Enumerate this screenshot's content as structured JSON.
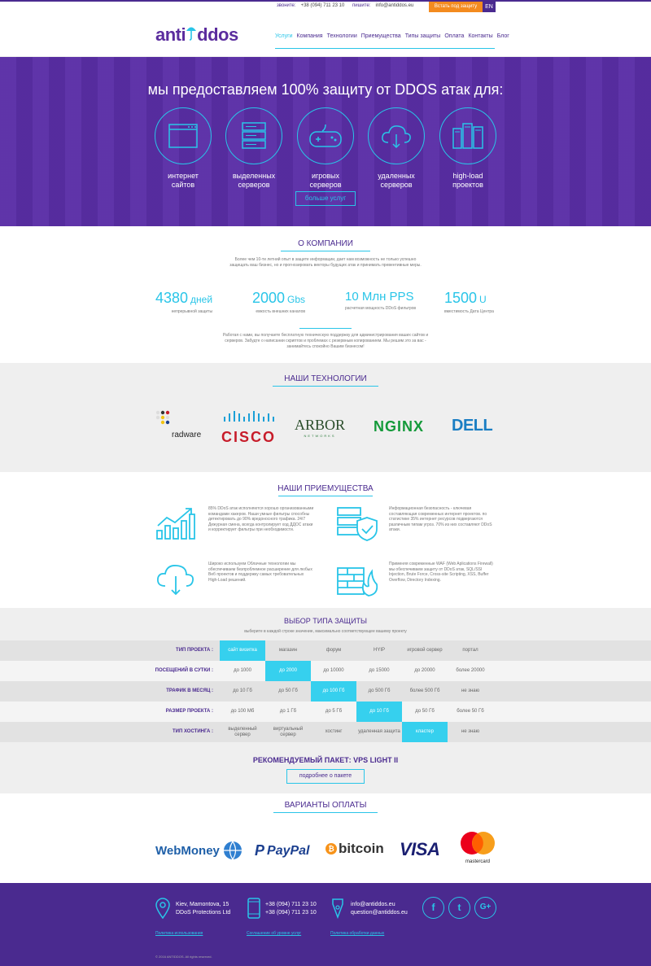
{
  "topbar": {
    "call_label": "звоните:",
    "phone": "+38 (094) 711 23 10",
    "write_label": "пишите:",
    "email": "info@antiddos.eu",
    "cta": "Встать под защиту",
    "lang": "EN"
  },
  "header": {
    "logo_left": "anti",
    "logo_right": "ddos",
    "nav": [
      "Услуги",
      "Компания",
      "Технологии",
      "Приемущества",
      "Типы защиты",
      "Оплата",
      "Контакты",
      "Блог"
    ]
  },
  "hero": {
    "title": "мы предоставляем 100% защиту от DDOS атак для:",
    "services": [
      {
        "icon": "browser-window-icon",
        "line1": "интернет",
        "line2": "сайтов"
      },
      {
        "icon": "server-stack-icon",
        "line1": "выделенных",
        "line2": "серверов"
      },
      {
        "icon": "gamepad-icon",
        "line1": "игровых",
        "line2": "серверов"
      },
      {
        "icon": "cloud-download-icon",
        "line1": "удаленных",
        "line2": "серверов"
      },
      {
        "icon": "server-rack-icon",
        "line1": "high-load",
        "line2": "проектов"
      }
    ],
    "more": "больше услуг"
  },
  "about": {
    "title": "О КОМПАНИИ",
    "intro": "Более чем 10-ти летний опыт в защите информации, дает нам возможность не только успешно защищать ваш бизнес, но и прогнозировать векторы будущих атак и принимать превентивные меры.",
    "stats": [
      {
        "value": "4380",
        "unit": "дней",
        "caption": "непрерывной защиты"
      },
      {
        "value": "2000",
        "unit": "Gbs",
        "caption": "емкость внешних каналов"
      },
      {
        "value": "10 Млн PPS",
        "unit": "",
        "caption": "расчетная мощность DDoS фильтров"
      },
      {
        "value": "1500",
        "unit": "U",
        "caption": "вместимость Дата Центра"
      }
    ],
    "outro": "Работая с нами, вы получаете бесплатную техническую поддержку для администрирования ваших сайтов и серверов. Забудте о написании скриптов и проблемах с резервным копированием. Мы решим это за вас - занимайтесь спокойно Вашим бизнесом!"
  },
  "tech": {
    "title": "НАШИ ТЕХНОЛОГИИ",
    "brands": [
      "radware",
      "CISCO",
      "ARBOR",
      "NETWORKS",
      "NGINX",
      "DELL"
    ]
  },
  "advantages": {
    "title": "НАШИ ПРИЕМУЩЕСТВА",
    "items": [
      {
        "icon": "growth-chart-icon",
        "text": "85% DDoS атак исполняются хорошо организованными командами хакеров. Наши умные фильтры способны детектировать до 90% вредоносного трафика. 24/7 Дежурная смена, всегда контролирует ход ДДОС атаки и корректирует фильтры при необходимости."
      },
      {
        "icon": "shield-server-icon",
        "text": "Информационная безопасность - ключевая составляющая современных интернет проектов. по статистике 35% интернет ресурсов подвергаются различным типам угроз. 70% из них составляют DDoS атаки."
      },
      {
        "icon": "cloud-download-icon",
        "text": "Широко используем Облачные технологии мы обеспечиваем безпроблемное расширение для любых Веб проектов и поддержку самых требовательных High-Load решений."
      },
      {
        "icon": "firewall-icon",
        "text": "Применяя современные WAF (Web Aplications Firewall) мы обеспечиваем защиту от DDoS атак, SQL/SSI Injection, Brute Force, Cross-site Scripting, XSS, Buffer Overflow, Directory Indexing."
      }
    ]
  },
  "protection": {
    "title": "ВЫБОР ТИПА ЗАЩИТЫ",
    "subtitle": "выберите в каждой строке значение, максимально соответствующее вашему проекту",
    "rows": [
      {
        "label": "ТИП ПРОЕКТА :",
        "cells": [
          "сайт визитка",
          "магазин",
          "форум",
          "HYIP",
          "игровой сервер",
          "портал"
        ],
        "selected": 0
      },
      {
        "label": "ПОСЕЩЕНИЙ В СУТКИ :",
        "cells": [
          "до 1000",
          "до 2000",
          "до 10000",
          "до 15000",
          "до 20000",
          "более 20000"
        ],
        "selected": 1
      },
      {
        "label": "ТРАФИК В МЕСЯЦ :",
        "cells": [
          "до 10 Гб",
          "до 50 Гб",
          "до 100 Гб",
          "до 500 Гб",
          "более 500 Гб",
          "не знаю"
        ],
        "selected": 2
      },
      {
        "label": "РАЗМЕР ПРОЕКТА :",
        "cells": [
          "до 100 Мб",
          "до 1 Гб",
          "до 5 Гб",
          "до 10 Гб",
          "до 50 Гб",
          "более 50 Гб"
        ],
        "selected": 3
      },
      {
        "label": "ТИП ХОСТИНГА :",
        "cells": [
          "выделенный сервер",
          "виртуальный сервер",
          "хостинг",
          "удаленная защита",
          "кластер",
          "не знаю"
        ],
        "selected": 4
      }
    ],
    "recommended": "РЕКОМЕНДУЕМЫЙ ПАКЕТ:  VPS LIGHT II",
    "button": "подробнее о пакете"
  },
  "payment": {
    "title": "ВАРИАНТЫ ОПЛАТЫ",
    "methods": [
      "WebMoney",
      "PayPal",
      "bitcoin",
      "VISA",
      "mastercard"
    ]
  },
  "footer": {
    "address1": "Kiev, Mamontova, 15",
    "address2": "DDoS Protections Ltd",
    "phone1": "+38 (094) 711 23 10",
    "phone2": "+38 (094) 711 23 10",
    "email1": "info@antiddos.eu",
    "email2": "question@antiddos.eu",
    "link1": "Политика использования",
    "link2": "Соглашение об уровне услуг",
    "link3": "Политика обработки данных",
    "copyright": "© 2016 ANTIDDOS. All rights reserved."
  },
  "colors": {
    "brand": "#4a2a8f",
    "accent": "#29c5e8",
    "cta": "#f38b1f"
  }
}
